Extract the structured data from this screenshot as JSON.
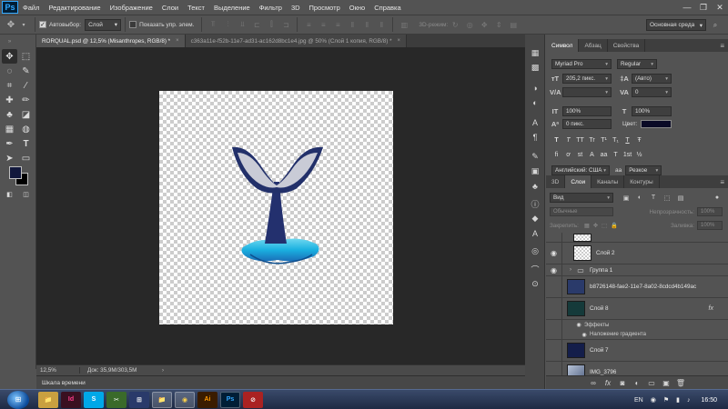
{
  "app": {
    "logo": "Ps",
    "name": "Adobe Photoshop"
  },
  "menu": [
    "Файл",
    "Редактирование",
    "Изображение",
    "Слои",
    "Текст",
    "Выделение",
    "Фильтр",
    "3D",
    "Просмотр",
    "Окно",
    "Справка"
  ],
  "window_controls": {
    "minimize": "—",
    "maximize": "❐",
    "close": "✕"
  },
  "options": {
    "autoselect_label": "Автовыбор:",
    "autoselect_checked": true,
    "autoselect_value": "Слой",
    "show_transform_label": "Показать упр. элем.",
    "show_transform_checked": false,
    "mode3d_label": "3D-режим:",
    "workspace": "Основная среда"
  },
  "tabs": [
    {
      "label": "RORQUAL.psd @ 12,5% (Misanthropes, RGB/8) *",
      "active": true
    },
    {
      "label": "c363a11e-f52b-11e7-ad31-ac162d8bc1e4.jpg @ 50% (Слой 1 копия, RGB/8) *",
      "active": false
    }
  ],
  "tab_close": "×",
  "status": {
    "zoom": "12,5%",
    "doc": "Док: 35,9M/303,5M",
    "arrow": "›"
  },
  "timeline": {
    "label": "Шкала времени",
    "menu": "≡"
  },
  "character": {
    "tabs": [
      "Символ",
      "Абзац",
      "Свойства"
    ],
    "font_family": "Myriad Pro",
    "font_style": "Regular",
    "font_size": "205,2 пикс.",
    "leading": "(Авто)",
    "kerning": "",
    "tracking": "0",
    "vscale": "100%",
    "hscale": "100%",
    "baseline": "0 пикс.",
    "color_label": "Цвет:",
    "color_hex": "#0a0a26",
    "style_buttons": [
      "T",
      "T",
      "TT",
      "Tr",
      "T¹",
      "T₁",
      "T",
      "Ŧ"
    ],
    "ot_buttons": [
      "ﬁ",
      "ơ",
      "st",
      "A",
      "aa",
      "T",
      "1st",
      "½"
    ],
    "language": "Английский: США",
    "antialias": "Резкое",
    "aa_label": "aa"
  },
  "layers": {
    "tabs": [
      "3D",
      "Слои",
      "Каналы",
      "Контуры"
    ],
    "kind_filter": "Вид",
    "blend_mode": "Обычные",
    "opacity_label": "Непрозрачность:",
    "opacity_value": "100%",
    "lock_label": "Закрепить:",
    "fill_label": "Заливка:",
    "fill_value": "100%",
    "items": [
      {
        "name": "",
        "visible": false,
        "thumb": "checker",
        "kind": "layer"
      },
      {
        "name": "Слой 2",
        "visible": true,
        "thumb": "checker",
        "kind": "layer"
      },
      {
        "name": "Группа 1",
        "visible": true,
        "thumb": "",
        "kind": "group"
      },
      {
        "name": "b8726148-fae2-11e7-8a02-8cdcd4b149ac",
        "visible": false,
        "thumb": "#2a3a6a",
        "kind": "layer"
      },
      {
        "name": "Слой 8",
        "visible": false,
        "thumb": "#153a3a",
        "kind": "layer",
        "fx": "fx"
      },
      {
        "name": "Эффекты",
        "kind": "effects"
      },
      {
        "name": "Наложение градиента",
        "kind": "effect"
      },
      {
        "name": "Слой 7",
        "visible": false,
        "thumb": "#141e4a",
        "kind": "layer"
      },
      {
        "name": "IMG_3796",
        "visible": false,
        "thumb": "#7a8aa6",
        "kind": "layer"
      }
    ]
  },
  "taskbar": {
    "start": "⊞",
    "apps": [
      {
        "name": "explorer",
        "label": "📁",
        "color": "#c9a040"
      },
      {
        "name": "indesign",
        "label": "Id",
        "color": "#3a1020"
      },
      {
        "name": "skype",
        "label": "S",
        "color": "#00a8e8"
      },
      {
        "name": "app4",
        "label": "✂",
        "color": "#3a6a2a"
      },
      {
        "name": "app5",
        "label": "⊞",
        "color": "#2a3a6a"
      },
      {
        "name": "explorer2",
        "label": "📁",
        "color": "#c9a040"
      },
      {
        "name": "chrome",
        "label": "◉",
        "color": "#2e8b3a"
      },
      {
        "name": "illustrator",
        "label": "Ai",
        "color": "#3a1c00"
      },
      {
        "name": "photoshop",
        "label": "Ps",
        "color": "#001e36"
      },
      {
        "name": "app10",
        "label": "⊘",
        "color": "#a22"
      }
    ],
    "lang": "EN",
    "clock": "16:50"
  }
}
